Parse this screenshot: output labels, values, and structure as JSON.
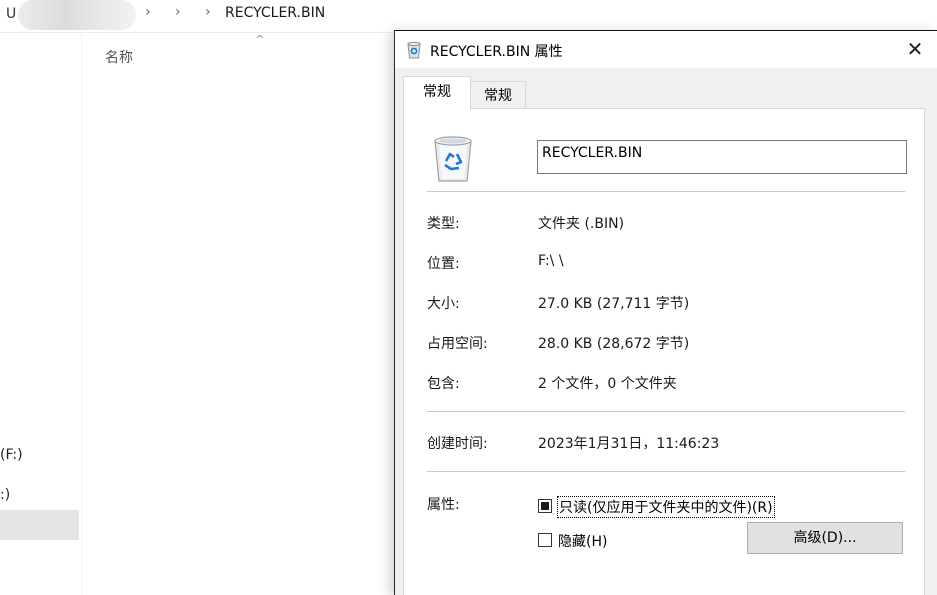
{
  "explorer": {
    "address_prefix": "U",
    "breadcrumb_current": "RECYCLER.BIN",
    "column_header_name": "名称",
    "nav_items": [
      "(F:)",
      ":)"
    ]
  },
  "dialog": {
    "title": "RECYCLER.BIN 属性",
    "close_glyph": "✕",
    "tabs": [
      {
        "label": "常规",
        "active": true
      },
      {
        "label": "常规",
        "active": false
      }
    ],
    "name_value": "RECYCLER.BIN",
    "properties": [
      {
        "label": "类型:",
        "value": "文件夹 (.BIN)"
      },
      {
        "label": "位置:",
        "value": "F:\\ \\"
      },
      {
        "label": "大小:",
        "value": "27.0 KB (27,711 字节)"
      },
      {
        "label": "占用空间:",
        "value": "28.0 KB (28,672 字节)"
      },
      {
        "label": "包含:",
        "value": "2 个文件，0 个文件夹"
      }
    ],
    "created": {
      "label": "创建时间:",
      "value": "2023年1月31日，11:46:23"
    },
    "attributes": {
      "label": "属性:",
      "readonly_label": "只读(仅应用于文件夹中的文件)(R)",
      "readonly_state": "indeterminate",
      "hidden_label": "隐藏(H)",
      "hidden_state": "unchecked",
      "advanced_button": "高级(D)..."
    }
  },
  "icons": {
    "title": "recycle-bin-icon",
    "large": "recycle-bin-icon"
  },
  "colors": {
    "accent_blue": "#1e7ad6",
    "dialog_bg": "#f0f0f0",
    "panel_bg": "#ffffff"
  }
}
